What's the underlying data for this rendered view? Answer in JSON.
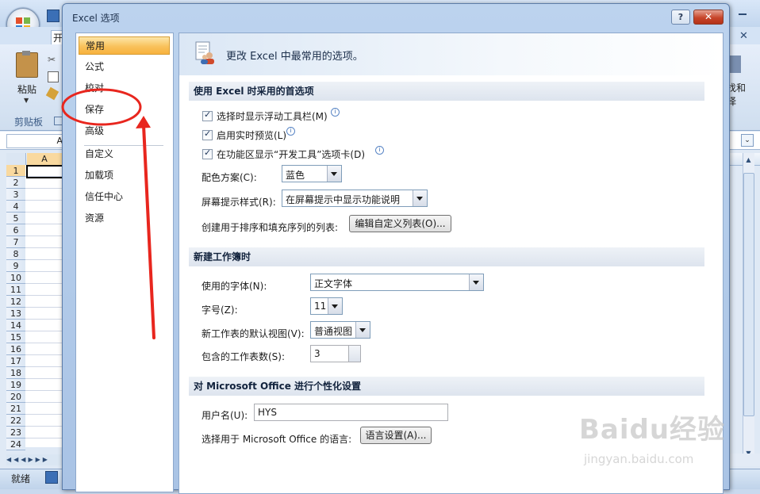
{
  "excel": {
    "home_tab": "开",
    "clipboard": {
      "paste_label": "粘贴",
      "group_label": "剪贴板"
    },
    "right_group_text": "找和择",
    "namebox": "A",
    "column_a": "A",
    "rows": [
      "1",
      "2",
      "3",
      "4",
      "5",
      "6",
      "7",
      "8",
      "9",
      "10",
      "11",
      "12",
      "13",
      "14",
      "15",
      "16",
      "17",
      "18",
      "19",
      "20",
      "21",
      "22",
      "23",
      "24"
    ],
    "status": "就绪"
  },
  "dialog": {
    "title": "Excel 选项",
    "help_label": "?",
    "close_label": "✕",
    "nav": [
      {
        "label": "常用",
        "active": true
      },
      {
        "label": "公式",
        "active": false
      },
      {
        "label": "校对",
        "active": false
      },
      {
        "label": "保存",
        "active": false
      },
      {
        "label": "高级",
        "active": false
      },
      {
        "label": "自定义",
        "active": false
      },
      {
        "label": "加载项",
        "active": false
      },
      {
        "label": "信任中心",
        "active": false
      },
      {
        "label": "资源",
        "active": false
      }
    ],
    "header_text": "更改 Excel 中最常用的选项。",
    "sections": {
      "top": "使用 Excel 时采用的首选项",
      "new_workbook": "新建工作簿时",
      "personalize": "对 Microsoft Office 进行个性化设置"
    },
    "checkboxes": [
      {
        "label": "选择时显示浮动工具栏(M)",
        "checked": true
      },
      {
        "label": "启用实时预览(L)",
        "checked": true
      },
      {
        "label": "在功能区显示“开发工具”选项卡(D)",
        "checked": true
      }
    ],
    "color_scheme": {
      "label": "配色方案(C):",
      "value": "蓝色"
    },
    "screentip": {
      "label": "屏幕提示样式(R):",
      "value": "在屏幕提示中显示功能说明"
    },
    "custom_lists": {
      "label": "创建用于排序和填充序列的列表:",
      "button": "编辑自定义列表(O)..."
    },
    "font": {
      "label": "使用的字体(N):",
      "value": "正文字体"
    },
    "font_size": {
      "label": "字号(Z):",
      "value": "11"
    },
    "default_view": {
      "label": "新工作表的默认视图(V):",
      "value": "普通视图"
    },
    "sheet_count": {
      "label": "包含的工作表数(S):",
      "value": "3"
    },
    "username": {
      "label": "用户名(U):",
      "value": "HYS"
    },
    "language": {
      "label": "选择用于 Microsoft Office 的语言:",
      "button": "语言设置(A)..."
    }
  },
  "watermark": {
    "main": "Baidu经验",
    "sub": "jingyan.baidu.com"
  },
  "annotation_color": "#e8261e"
}
